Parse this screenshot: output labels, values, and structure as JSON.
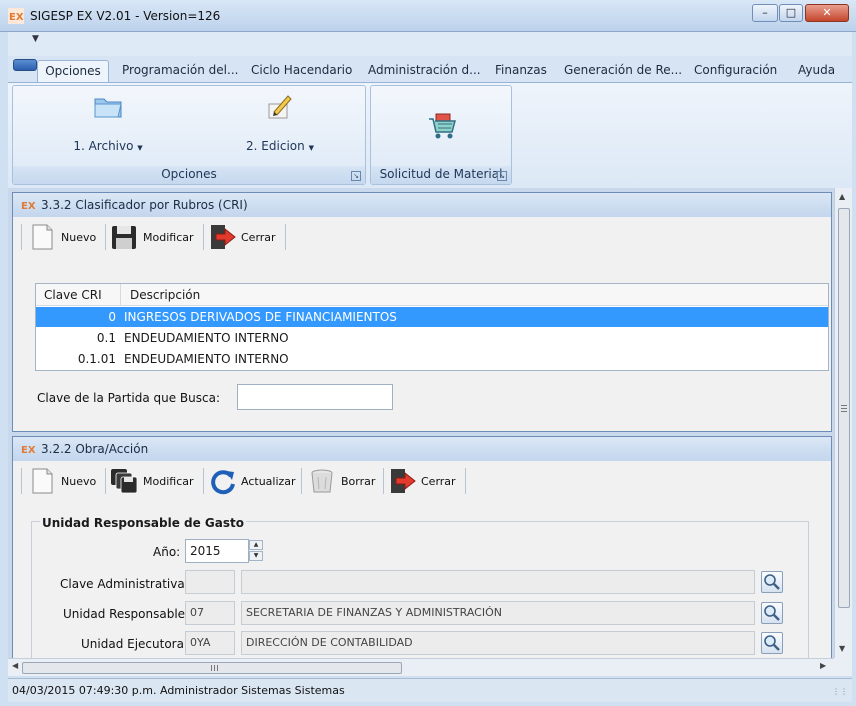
{
  "window": {
    "title": "SIGESP EX V2.01 - Version=126",
    "controls": [
      "minimize",
      "maximize",
      "close"
    ]
  },
  "ribbon": {
    "tabs": [
      "Opciones",
      "Programación del...",
      "Ciclo Hacendario",
      "Administración d...",
      "Finanzas",
      "Generación de Re...",
      "Configuración",
      "Ayuda"
    ],
    "active_tab": "Opciones",
    "groups": [
      {
        "label": "Opciones",
        "buttons": [
          {
            "label": "1. Archivo",
            "icon": "folder-icon"
          },
          {
            "label": "2. Edicion",
            "icon": "edit-pencil-icon"
          }
        ]
      },
      {
        "label": "Solicitud de Material",
        "buttons": [
          {
            "label": "",
            "icon": "shopping-cart-icon"
          }
        ]
      }
    ]
  },
  "cri_window": {
    "title": "3.3.2 Clasificador por Rubros (CRI)",
    "toolbar": {
      "nuevo": "Nuevo",
      "modificar": "Modificar",
      "cerrar": "Cerrar"
    },
    "grid": {
      "columns": [
        "Clave CRI",
        "Descripción"
      ],
      "rows": [
        {
          "clave": "0",
          "descripcion": "INGRESOS DERIVADOS DE FINANCIAMIENTOS",
          "selected": true
        },
        {
          "clave": "0.1",
          "descripcion": "ENDEUDAMIENTO INTERNO",
          "selected": false
        },
        {
          "clave": "0.1.01",
          "descripcion": "ENDEUDAMIENTO INTERNO",
          "selected": false
        }
      ]
    },
    "search_label": "Clave de la Partida que Busca:",
    "search_value": ""
  },
  "obra_window": {
    "title": "3.2.2 Obra/Acción",
    "toolbar": {
      "nuevo": "Nuevo",
      "modificar": "Modificar",
      "actualizar": "Actualizar",
      "borrar": "Borrar",
      "cerrar": "Cerrar"
    },
    "section_title": "Unidad Responsable de Gasto",
    "fields": {
      "anio_label": "Año:",
      "anio_value": "2015",
      "clave_admin_label": "Clave Administrativa:",
      "clave_admin_code": "",
      "clave_admin_desc": "",
      "unidad_resp_label": "Unidad Responsable:",
      "unidad_resp_code": "07",
      "unidad_resp_desc": "SECRETARIA DE FINANZAS Y ADMINISTRACIÓN",
      "unidad_ejec_label": "Unidad Ejecutora:",
      "unidad_ejec_code": "0YA",
      "unidad_ejec_desc": "DIRECCIÓN DE CONTABILIDAD"
    }
  },
  "status": {
    "text": "04/03/2015 07:49:30 p.m.   Administrador Sistemas Sistemas"
  },
  "colors": {
    "selection": "#3399ff",
    "ribbon": "#dce8f6",
    "titlebar": "#c3d6ed"
  }
}
